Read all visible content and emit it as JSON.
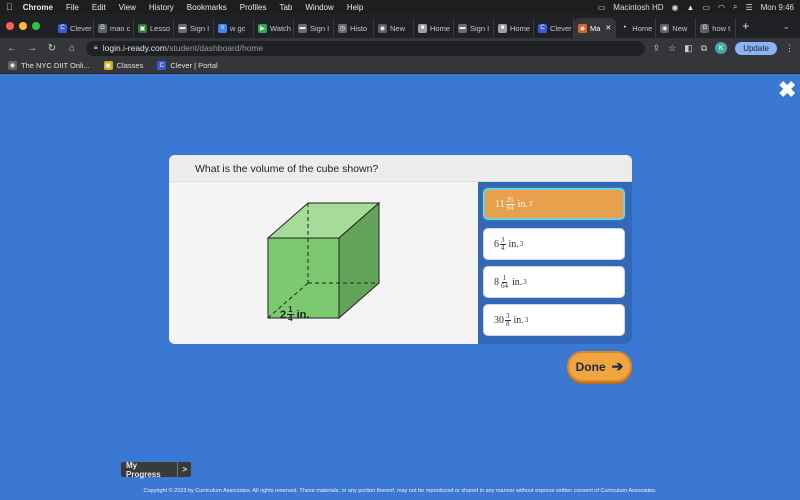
{
  "menubar": {
    "apple": "",
    "items": [
      "Chrome",
      "File",
      "Edit",
      "View",
      "History",
      "Bookmarks",
      "Profiles",
      "Tab",
      "Window",
      "Help"
    ],
    "disk": "Macintosh HD",
    "clock": "Mon 9:46"
  },
  "tabs": [
    {
      "label": "Clever",
      "icon": "C",
      "color": "#3b5bdb"
    },
    {
      "label": "man c",
      "icon": "G",
      "color": "#5f6368"
    },
    {
      "label": "Lesso",
      "icon": "▣",
      "color": "#2e7d32"
    },
    {
      "label": "Sign I",
      "icon": "▬",
      "color": "#6d6d6d"
    },
    {
      "label": "w gc",
      "icon": "≡",
      "color": "#4285f4"
    },
    {
      "label": "Watch",
      "icon": "▶",
      "color": "#34a853"
    },
    {
      "label": "Sign I",
      "icon": "▬",
      "color": "#6d6d6d"
    },
    {
      "label": "Histo",
      "icon": "◷",
      "color": "#6d6d6d"
    },
    {
      "label": "New",
      "icon": "◉",
      "color": "#5f6368"
    },
    {
      "label": "Home",
      "icon": "■",
      "color": "#9e9e9e"
    },
    {
      "label": "Sign I",
      "icon": "▬",
      "color": "#6d6d6d"
    },
    {
      "label": "Home",
      "icon": "■",
      "color": "#9e9e9e"
    },
    {
      "label": "Clever",
      "icon": "C",
      "color": "#3b5bdb"
    },
    {
      "label": "Ma",
      "icon": "◆",
      "color": "#e0622a",
      "active": true
    },
    {
      "label": "Home",
      "icon": "•",
      "color": "#222"
    },
    {
      "label": "New",
      "icon": "◉",
      "color": "#5f6368"
    },
    {
      "label": "how t",
      "icon": "G",
      "color": "#5f6368"
    }
  ],
  "newtab": "+",
  "address": {
    "host": "login.i-ready.com",
    "path": "/student/dashboard/home",
    "profile_initial": "K",
    "update_label": "Update"
  },
  "bookmarks": [
    {
      "label": "The NYC DIIT Onli...",
      "icon": "◉",
      "color": "#5f6368"
    },
    {
      "label": "Classes",
      "icon": "▣",
      "color": "#c9b21b"
    },
    {
      "label": "Clever | Portal",
      "icon": "C",
      "color": "#3b5bdb"
    }
  ],
  "question": {
    "text": "What is the volume of the cube shown?",
    "edge_label_whole": "2",
    "edge_label_num": "1",
    "edge_label_den": "4",
    "edge_label_unit": "in."
  },
  "choices": [
    {
      "whole": "11",
      "num": "25",
      "den": "64",
      "unit": "in.",
      "exp": "3",
      "selected": true
    },
    {
      "whole": "6",
      "num": "3",
      "den": "4",
      "unit": "in.",
      "exp": "3",
      "selected": false
    },
    {
      "whole": "8",
      "num": "1",
      "den": "64",
      "unit": "in.",
      "exp": "3",
      "selected": false
    },
    {
      "whole": "30",
      "num": "3",
      "den": "8",
      "unit": "in.",
      "exp": "3",
      "selected": false
    }
  ],
  "done_label": "Done",
  "close_label": "✖",
  "my_progress": {
    "label": "My Progress",
    "chevron": ">"
  },
  "footer": "Copyright © 2023 by Curriculum Associates. All rights reserved. These materials, or any portion thereof, may not be reproduced or shared in any manner without express written consent of Curriculum Associates.",
  "colors": {
    "page_bg": "#3b78d4",
    "answers_panel": "#3368b8",
    "selected_choice": "#e9a04c",
    "done_button": "#f0a53e",
    "cube_front": "#7cc96f",
    "cube_top": "#a6dc9a",
    "cube_side": "#62a45a"
  }
}
